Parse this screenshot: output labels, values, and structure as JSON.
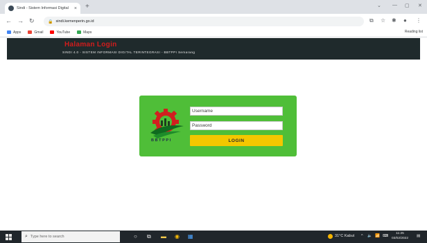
{
  "browser": {
    "tab_title": "Sindi - Sistem Informasi Digital",
    "tab_close": "×",
    "new_tab": "+",
    "url": "sindi.kemenperin.go.id",
    "bookmarks": [
      {
        "label": "Apps",
        "color": "#4285f4"
      },
      {
        "label": "Gmail",
        "color": "#ea4335"
      },
      {
        "label": "YouTube",
        "color": "#ff0000"
      },
      {
        "label": "Maps",
        "color": "#34a853"
      }
    ],
    "reading_list": "Reading list"
  },
  "site": {
    "title": "Halaman Login",
    "subtitle": "SINDI 4.0 - SISTEM INFORMASI DIGITAL TERINTEGRASI - BBTPPI Semarang",
    "header_bg": "#1f2a2c",
    "title_color": "#d21c1c"
  },
  "login": {
    "logo_text": "BBTPPI",
    "username_placeholder": "Username",
    "password_placeholder": "Password",
    "button_label": "LOGIN",
    "card_color": "#4fbe38",
    "button_color": "#f4c700"
  },
  "taskbar": {
    "search_placeholder": "Type here to search",
    "weather": "31°C Kabut",
    "time": "11:25",
    "date": "03/02/2022"
  }
}
